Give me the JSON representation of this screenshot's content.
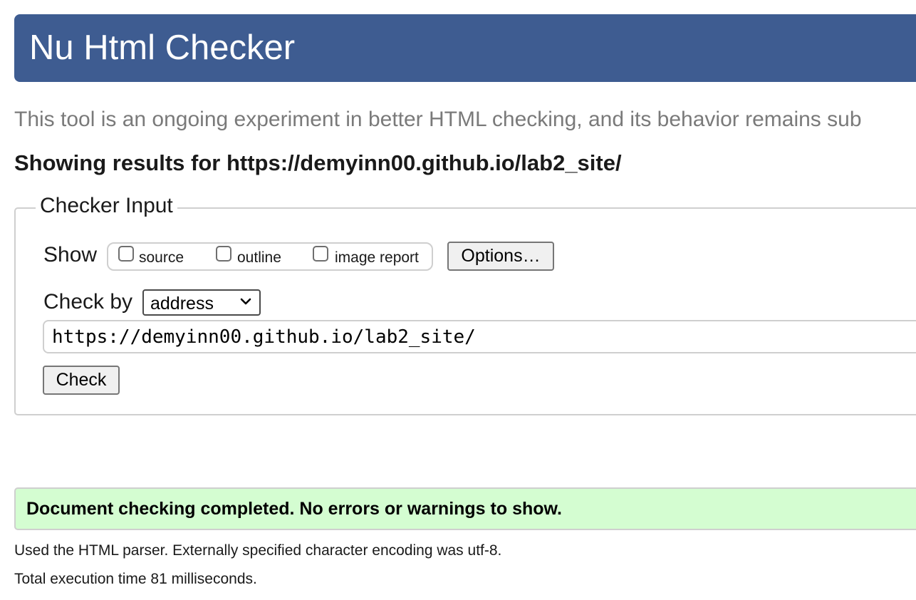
{
  "header": {
    "title": "Nu Html Checker"
  },
  "intro": {
    "text": "This tool is an ongoing experiment in better HTML checking, and its behavior remains sub"
  },
  "results": {
    "heading": "Showing results for https://demyinn00.github.io/lab2_site/"
  },
  "checker_input": {
    "legend": "Checker Input",
    "show_label": "Show",
    "options": [
      {
        "label": "source",
        "checked": false
      },
      {
        "label": "outline",
        "checked": false
      },
      {
        "label": "image report",
        "checked": false
      }
    ],
    "options_button": "Options…",
    "check_by_label": "Check by",
    "check_by_value": "address",
    "url_value": "https://demyinn00.github.io/lab2_site/",
    "check_button": "Check"
  },
  "status": {
    "message": "Document checking completed. No errors or warnings to show.",
    "color": "#d4fdd1"
  },
  "info": {
    "parser": "Used the HTML parser. Externally specified character encoding was utf-8.",
    "execution": "Total execution time 81 milliseconds."
  },
  "colors": {
    "header_bg": "#3e5c91",
    "intro_text": "#7a7a7a"
  }
}
